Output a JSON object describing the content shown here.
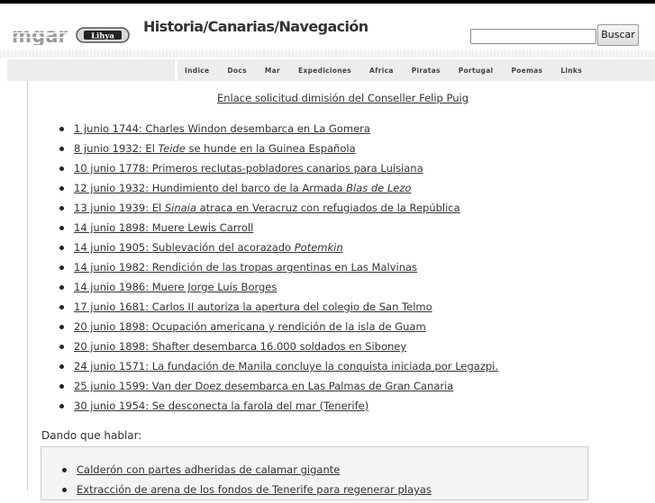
{
  "header": {
    "logo_text": "mgar",
    "badge_text": "Lihya",
    "title": "Historia/Canarias/Navegación",
    "search": {
      "value": "",
      "placeholder": ""
    },
    "search_button": "Buscar"
  },
  "nav": {
    "items": [
      "Indice",
      "Docs",
      "Mar",
      "Expediciones",
      "Africa",
      "Piratas",
      "Portugal",
      "Poemas",
      "Links"
    ]
  },
  "main": {
    "petition_link": "Enlace solicitud dimisión del Conseller Felip Puig",
    "events": [
      [
        "1 junio 1744: Charles Windon desembarca en La Gomera"
      ],
      [
        "8 junio 1932: El ",
        "Teide",
        " se hunde en la Guinea Española"
      ],
      [
        "10 junio 1778: Primeros reclutas-pobladores canarios para Luisiana"
      ],
      [
        "12 junio 1932: Hundimiento del barco de la Armada ",
        "Blas de Lezo",
        ""
      ],
      [
        "13 junio 1939: El ",
        "Sinaia",
        " atraca en Veracruz con refugiados de la República"
      ],
      [
        "14 junio 1898: Muere Lewis Carroll"
      ],
      [
        "14 junio 1905: Sublevación del acorazado ",
        "Potemkin",
        ""
      ],
      [
        "14 junio 1982: Rendición de las tropas argentinas en Las Malvinas"
      ],
      [
        "14 junio 1986: Muere Jorge Luis Borges"
      ],
      [
        "17 junio 1681: Carlos II autoriza la apertura del colegio de San Telmo"
      ],
      [
        "20 junio 1898: Ocupación americana y rendición de la isla de Guam"
      ],
      [
        "20 junio 1898: Shafter desembarca 16.000 soldados en Siboney"
      ],
      [
        "24 junio 1571: La fundación de Manila concluye la conquista iniciada por Legazpi."
      ],
      [
        "25 junio 1599: Van der Doez desembarca en Las Palmas de Gran Canaria"
      ],
      [
        "30 junio 1954: Se desconecta la farola del mar (Tenerife)"
      ]
    ],
    "talk_title": "Dando que hablar:",
    "talk_items": [
      "Calderón con partes adheridas de calamar gigante",
      "Extracción de arena de los fondos de Tenerife para regenerar playas"
    ]
  }
}
